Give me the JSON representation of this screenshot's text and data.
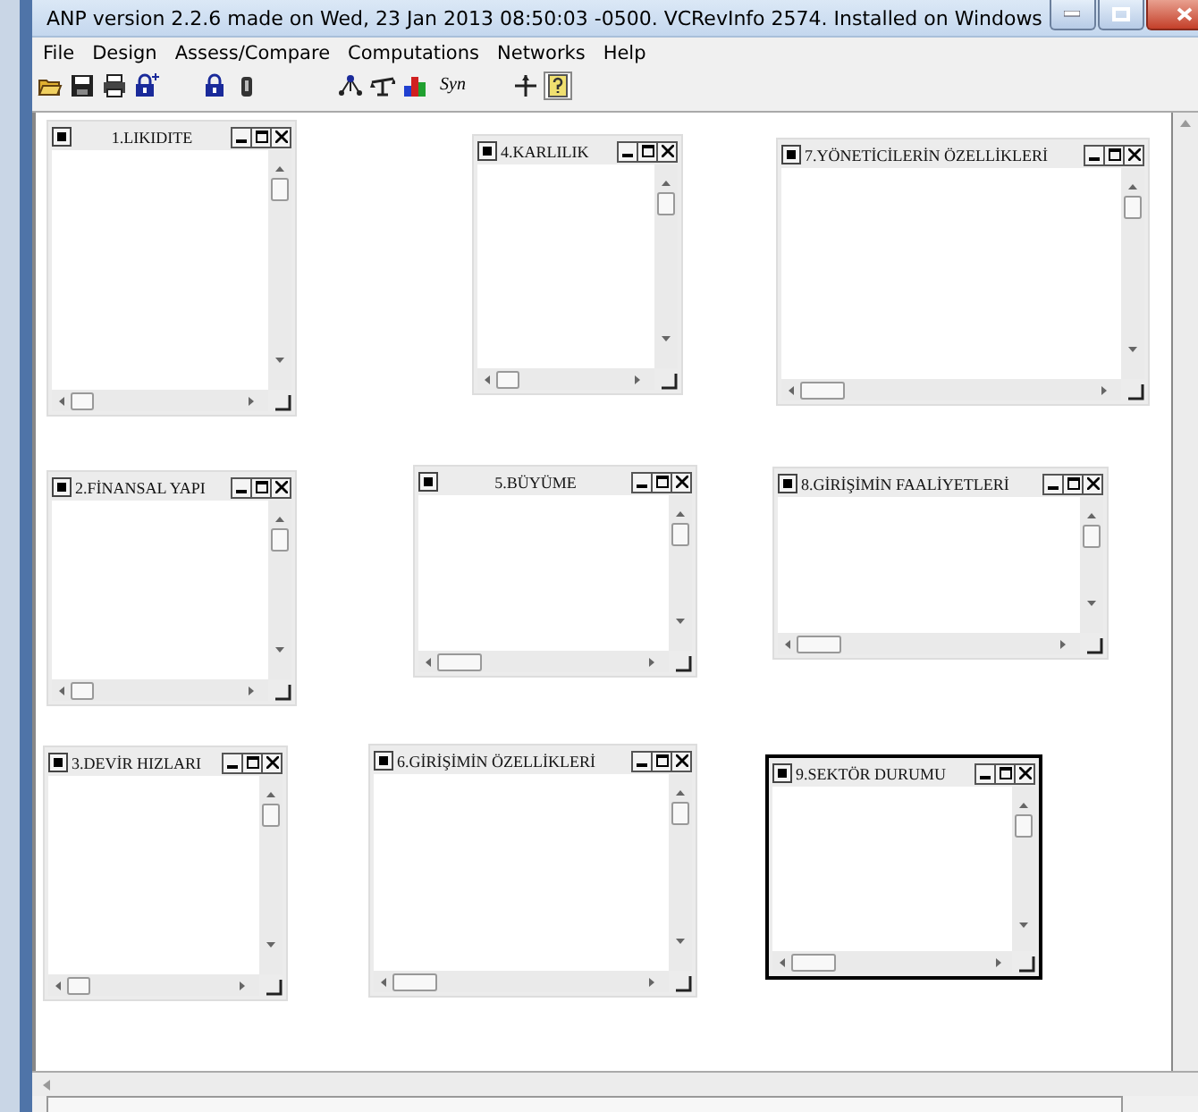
{
  "window": {
    "title": "ANP version 2.2.6 made on Wed, 23 Jan 2013 08:50:03 -0500.  VCRevInfo 2574.  Installed on Windows"
  },
  "menu": [
    "File",
    "Design",
    "Assess/Compare",
    "Computations",
    "Networks",
    "Help"
  ],
  "toolbar": {
    "syn_label": "Syn",
    "last_button_pressed": true
  },
  "clusters": [
    {
      "title": "1.LIKIDITE",
      "title_centered": true,
      "selected": false
    },
    {
      "title": "4.KARLILIK",
      "title_centered": false,
      "selected": false
    },
    {
      "title": "7.YÖNETİCİLERİN ÖZELLİKLERİ",
      "title_centered": false,
      "selected": false
    },
    {
      "title": "2.FİNANSAL YAPI",
      "title_centered": false,
      "selected": false
    },
    {
      "title": "5.BÜYÜME",
      "title_centered": true,
      "selected": false
    },
    {
      "title": "8.GİRİŞİMİN FAALİYETLERİ",
      "title_centered": false,
      "selected": false
    },
    {
      "title": "3.DEVİR HIZLARI",
      "title_centered": false,
      "selected": false
    },
    {
      "title": "6.GİRİŞİMİN ÖZELLİKLERİ",
      "title_centered": false,
      "selected": false
    },
    {
      "title": "9.SEKTÖR DURUMU",
      "title_centered": false,
      "selected": true
    }
  ]
}
